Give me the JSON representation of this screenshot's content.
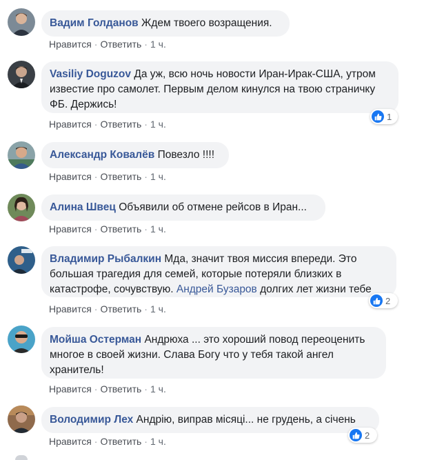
{
  "actions": {
    "like_label": "Нравится",
    "reply_label": "Ответить",
    "separator": "·"
  },
  "comments": [
    {
      "author": "Вадим Голданов",
      "text": "Ждем твоего возращения.",
      "time": "1 ч.",
      "reactions": null
    },
    {
      "author": "Vasiliy Doguzov",
      "text": "Да уж, всю ночь новости Иран-Ирак-США, утром известие про самолет. Первым делом кинулся на твою страничку ФБ. Держись!",
      "time": "1 ч.",
      "reactions": "1"
    },
    {
      "author": "Александр Ковалёв",
      "text": "Повезло !!!!",
      "time": "1 ч.",
      "reactions": null
    },
    {
      "author": "Алина Швец",
      "text": "Объявили об отмене рейсов в Иран...",
      "time": "1 ч.",
      "reactions": null
    },
    {
      "author": "Владимир Рыбалкин",
      "text_before": "Мда, значит твоя миссия впереди. Это большая трагедия для семей, которые потеряли близких в катастрофе, сочувствую.",
      "mention": "Андрей Бузаров",
      "text_after": "долгих лет жизни тебе",
      "time": "1 ч.",
      "reactions": "2"
    },
    {
      "author": "Мойша Остерман",
      "text": "Андрюха ... это хороший повод переоценить многое в своей жизни. Слава Богу что у тебя такой ангел хранитель!",
      "time": "1 ч.",
      "reactions": null
    },
    {
      "author": "Володимир Лех",
      "text": "Андрію, виправ місяці... не грудень, а січень",
      "time": "1 ч.",
      "reactions": "2"
    }
  ],
  "colors": {
    "author_link": "#385898",
    "bubble_bg": "#f2f3f5",
    "meta_text": "#606770",
    "like_blue": "#1877f2"
  }
}
